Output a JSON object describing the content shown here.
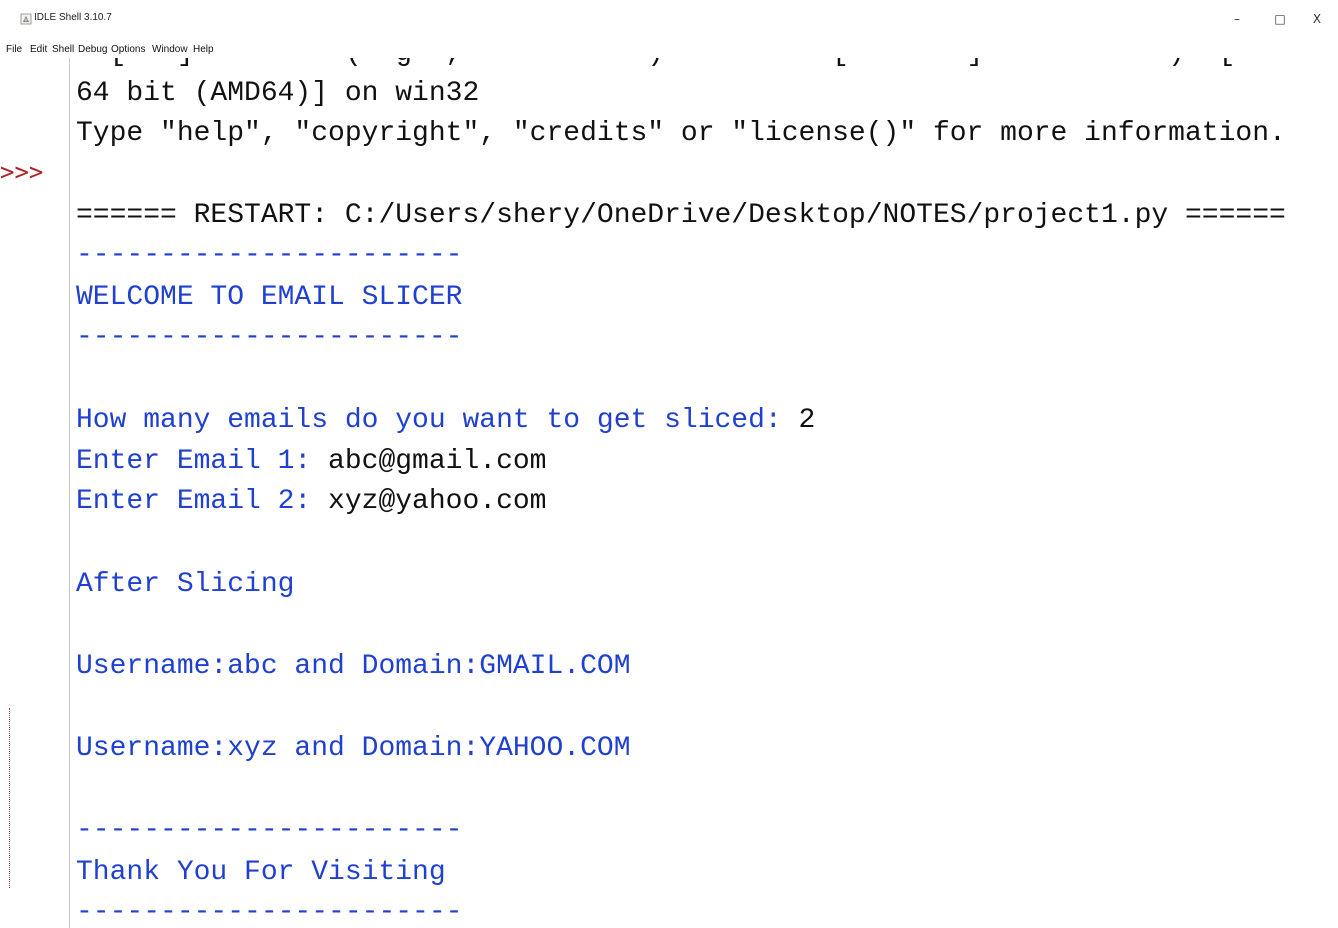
{
  "window": {
    "title": "IDLE Shell 3.10.7",
    "controls": {
      "minimize": "–",
      "maximize": "□",
      "close": "X"
    }
  },
  "menu": {
    "items": [
      "File",
      "Edit",
      "Shell",
      "Debug",
      "Options",
      "Window",
      "Help"
    ]
  },
  "shell": {
    "prompt": ">>>",
    "partial_line": "  [   ]         (  g  ,           )          [       ]           )  [",
    "line_arch": "64 bit (AMD64)] on win32",
    "line_help": "Type \"help\", \"copyright\", \"credits\" or \"license()\" for more information.",
    "restart": "====== RESTART: C:/Users/shery/OneDrive/Desktop/NOTES/project1.py ======",
    "divider": "-----------------------",
    "welcome": "WELCOME TO EMAIL SLICER",
    "q_count_label": "How many emails do you want to get sliced: ",
    "q_count_value": "2",
    "email1_label": "Enter Email 1: ",
    "email1_value": "abc@gmail.com",
    "email2_label": "Enter Email 2: ",
    "email2_value": "xyz@yahoo.com",
    "after_slicing": "After Slicing",
    "result1": "Username:abc and Domain:GMAIL.COM",
    "result2": "Username:xyz and Domain:YAHOO.COM",
    "thanks": "Thank You For Visiting"
  },
  "colors": {
    "output_blue": "#2040d0",
    "input_black": "#111111",
    "prompt_red": "#b22222"
  }
}
